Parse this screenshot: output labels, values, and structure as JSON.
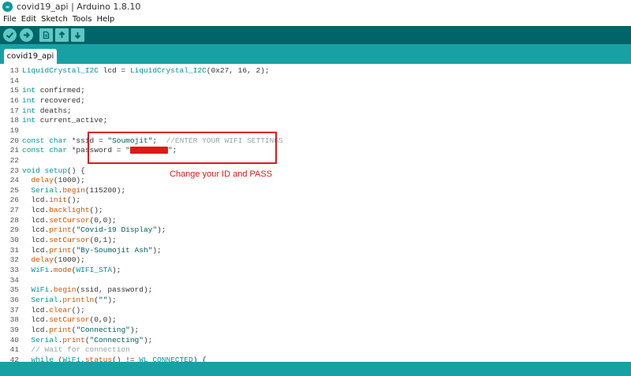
{
  "window": {
    "title": "covid19_api | Arduino 1.8.10",
    "logo_icon": "arduino-logo-icon",
    "logo_text": "∞"
  },
  "menu": [
    "File",
    "Edit",
    "Sketch",
    "Tools",
    "Help"
  ],
  "toolbar": {
    "buttons": [
      "verify-icon",
      "upload-icon",
      "new-icon",
      "open-icon",
      "save-icon"
    ]
  },
  "tab": {
    "label": "covid19_api"
  },
  "code_lines": [
    {
      "n": "13",
      "html": "<span class='k'>LiquidCrystal_I2C</span> lcd = <span class='k'>LiquidCrystal_I2C</span>(0x27, 16, 2);"
    },
    {
      "n": "14",
      "html": ""
    },
    {
      "n": "15",
      "html": "<span class='k'>int</span> confirmed;"
    },
    {
      "n": "16",
      "html": "<span class='k'>int</span> recovered;"
    },
    {
      "n": "17",
      "html": "<span class='k'>int</span> deaths;"
    },
    {
      "n": "18",
      "html": "<span class='k'>int</span> current_active;"
    },
    {
      "n": "19",
      "html": ""
    },
    {
      "n": "20",
      "html": "<span class='k'>const</span> <span class='k'>char</span> *ssid = <span class='s'>\"Soumojit\"</span>;  <span class='c'>//ENTER YOUR WIFI SETTINGS</span>"
    },
    {
      "n": "21",
      "html": "<span class='k'>const</span> <span class='k'>char</span> *password = <span class='s'>\"<span class='redact'></span>\"</span>;"
    },
    {
      "n": "22",
      "html": ""
    },
    {
      "n": "23",
      "html": "<span class='k'>void</span> <span class='k'>setup</span>() {"
    },
    {
      "n": "24",
      "html": "  <span class='f'>delay</span>(1000);"
    },
    {
      "n": "25",
      "html": "  <span class='k'>Serial</span>.<span class='f'>begin</span>(115200);"
    },
    {
      "n": "26",
      "html": "  lcd.<span class='f'>init</span>();"
    },
    {
      "n": "27",
      "html": "  lcd.<span class='f'>backlight</span>();"
    },
    {
      "n": "28",
      "html": "  lcd.<span class='f'>setCursor</span>(0,0);"
    },
    {
      "n": "29",
      "html": "  lcd.<span class='f'>print</span>(<span class='s'>\"Covid-19 Display\"</span>);"
    },
    {
      "n": "30",
      "html": "  lcd.<span class='f'>setCursor</span>(0,1);"
    },
    {
      "n": "31",
      "html": "  lcd.<span class='f'>print</span>(<span class='s'>\"By-Soumojit Ash\"</span>);"
    },
    {
      "n": "32",
      "html": "  <span class='f'>delay</span>(1000);"
    },
    {
      "n": "33",
      "html": "  <span class='k'>WiFi</span>.<span class='f'>mode</span>(<span class='k'>WIFI_STA</span>);"
    },
    {
      "n": "34",
      "html": ""
    },
    {
      "n": "35",
      "html": "  <span class='k'>WiFi</span>.<span class='f'>begin</span>(ssid, password);"
    },
    {
      "n": "36",
      "html": "  <span class='k'>Serial</span>.<span class='f'>println</span>(<span class='s'>\"\"</span>);"
    },
    {
      "n": "37",
      "html": "  lcd.<span class='f'>clear</span>();"
    },
    {
      "n": "38",
      "html": "  lcd.<span class='f'>setCursor</span>(0,0);"
    },
    {
      "n": "39",
      "html": "  lcd.<span class='f'>print</span>(<span class='s'>\"Connecting\"</span>);"
    },
    {
      "n": "40",
      "html": "  <span class='k'>Serial</span>.<span class='f'>print</span>(<span class='s'>\"Connecting\"</span>);"
    },
    {
      "n": "41",
      "html": "  <span class='c'>// Wait for connection</span>"
    },
    {
      "n": "42",
      "html": "  <span class='k'>while</span> (<span class='k'>WiFi</span>.<span class='f'>status</span>() != <span class='k'>WL_CONNECTED</span>) {"
    }
  ],
  "annotation": "Change your ID and PASS",
  "colors": {
    "toolbar": "#006468",
    "tabstrip": "#17a1a5",
    "highlight": "#e01818"
  }
}
